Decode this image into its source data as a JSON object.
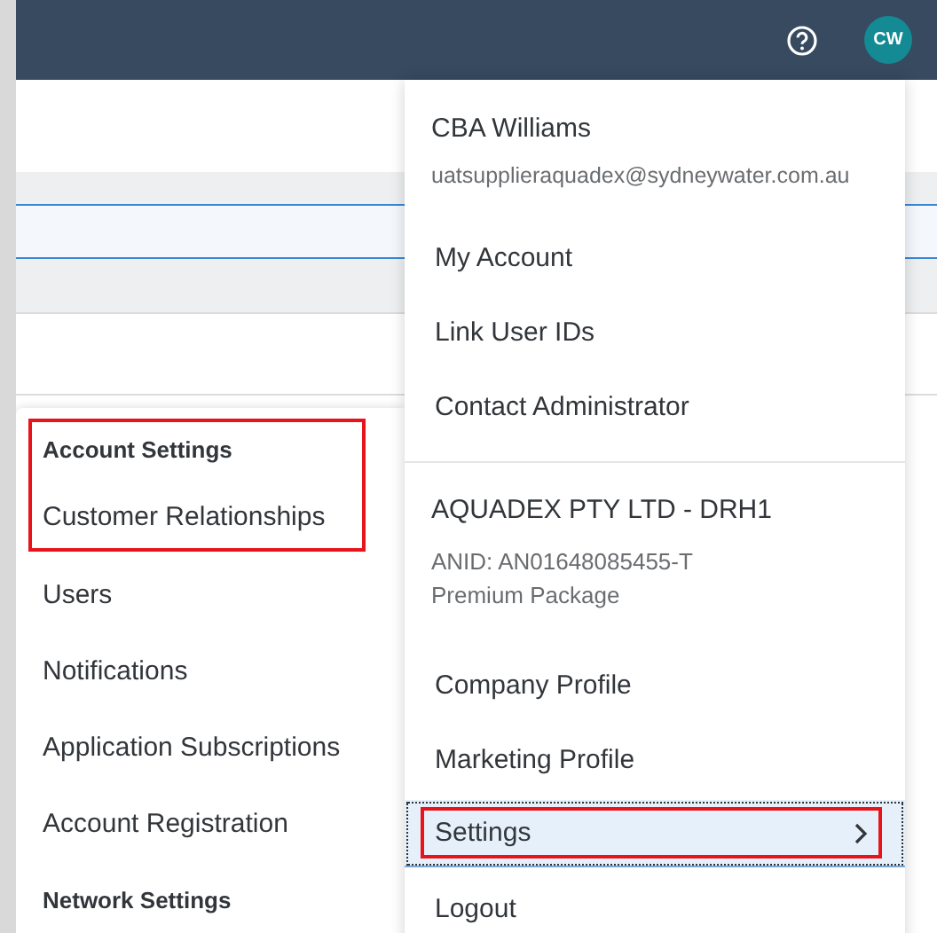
{
  "header": {
    "avatar": {
      "initials": "CW"
    }
  },
  "background_rows": [
    {
      "kind": "blank"
    },
    {
      "kind": "band"
    },
    {
      "kind": "selected"
    },
    {
      "kind": "band"
    },
    {
      "kind": "blank"
    }
  ],
  "user_menu": {
    "sections": [
      {
        "kind": "user",
        "name": "CBA Williams",
        "email": "uatsupplieraquadex@sydneywater.com.au"
      },
      {
        "kind": "links",
        "items": [
          {
            "label": "My Account",
            "selected": false,
            "highlighted": false,
            "submenu": false
          },
          {
            "label": "Link User IDs",
            "selected": false,
            "highlighted": false,
            "submenu": false
          },
          {
            "label": "Contact Administrator",
            "selected": false,
            "highlighted": false,
            "submenu": false
          }
        ]
      },
      {
        "kind": "company",
        "name": "AQUADEX PTY LTD - DRH1",
        "anid": "ANID: AN01648085455-T",
        "package": "Premium Package"
      },
      {
        "kind": "links",
        "items": [
          {
            "label": "Company Profile",
            "selected": false,
            "highlighted": false,
            "submenu": false
          },
          {
            "label": "Marketing Profile",
            "selected": false,
            "highlighted": false,
            "submenu": false
          },
          {
            "label": "Settings",
            "selected": true,
            "highlighted": true,
            "submenu": true
          },
          {
            "label": "Logout",
            "selected": false,
            "highlighted": false,
            "submenu": false
          }
        ]
      }
    ]
  },
  "settings_menu": {
    "items": [
      {
        "kind": "heading",
        "label": "Account Settings",
        "highlighted": true
      },
      {
        "kind": "link",
        "label": "Customer Relationships",
        "highlighted": true
      },
      {
        "kind": "link",
        "label": "Users",
        "highlighted": false
      },
      {
        "kind": "link",
        "label": "Notifications",
        "highlighted": false
      },
      {
        "kind": "link",
        "label": "Application Subscriptions",
        "highlighted": false
      },
      {
        "kind": "link",
        "label": "Account Registration",
        "highlighted": false
      },
      {
        "kind": "heading",
        "label": "Network Settings",
        "highlighted": false
      }
    ]
  }
}
